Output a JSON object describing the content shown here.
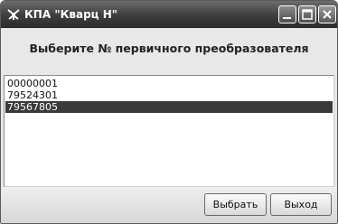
{
  "window": {
    "title": "КПА \"Кварц Н\"",
    "icon": "app-icon",
    "controls": [
      "minimize-icon",
      "maximize-icon",
      "close-icon"
    ]
  },
  "main": {
    "heading": "Выберите № первичного преобразователя",
    "list": {
      "items": [
        {
          "label": "00000001",
          "selected": false
        },
        {
          "label": "79524301",
          "selected": false
        },
        {
          "label": "79567805",
          "selected": true
        }
      ]
    }
  },
  "footer": {
    "select_label": "Выбрать",
    "exit_label": "Выход"
  },
  "colors": {
    "titlebar": "#3e3e3e",
    "selection": "#3a3a3a",
    "background": "#e6e6e6"
  }
}
